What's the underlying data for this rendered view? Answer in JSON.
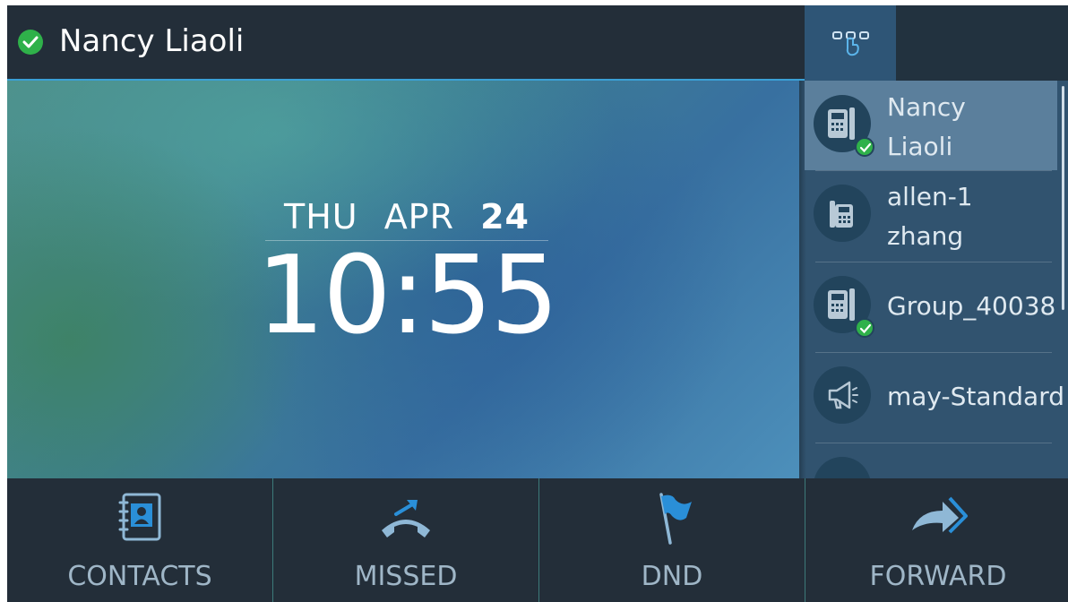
{
  "header": {
    "user_name": "Nancy Liaoli",
    "status_color": "#2fb14a"
  },
  "clock": {
    "weekday": "THU",
    "month": "APR",
    "day": "24",
    "time": "10:55"
  },
  "line_keys": [
    {
      "line1": "Nancy",
      "line2": "Liaoli",
      "icon": "desk-phone-icon",
      "status": "registered",
      "active": true
    },
    {
      "line1": "allen-1",
      "line2": "zhang",
      "icon": "desk-phone-icon",
      "status": "none",
      "active": false
    },
    {
      "line1": "Group_40038",
      "line2": "",
      "icon": "desk-phone-icon",
      "status": "registered",
      "active": false
    },
    {
      "line1": "may-Standard",
      "line2": "",
      "icon": "megaphone-icon",
      "status": "none",
      "active": false
    }
  ],
  "softkeys": [
    {
      "label": "CONTACTS",
      "icon": "contacts-icon"
    },
    {
      "label": "MISSED",
      "icon": "missed-call-icon"
    },
    {
      "label": "DND",
      "icon": "dnd-flag-icon"
    },
    {
      "label": "FORWARD",
      "icon": "forward-arrow-icon"
    }
  ],
  "colors": {
    "accent": "#3aa0d6",
    "bar": "#232e39",
    "panel": "#31536f"
  }
}
